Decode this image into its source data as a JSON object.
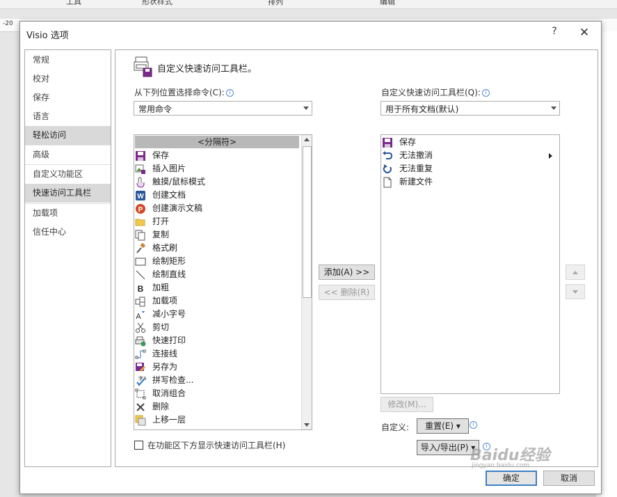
{
  "background": {
    "ribbon_groups": [
      "工具",
      "形状样式",
      "排列",
      "编辑"
    ],
    "ruler_label": "-20"
  },
  "dialog": {
    "title": "Visio 选项",
    "help_label": "?",
    "close_label": "✕"
  },
  "nav": {
    "items": [
      {
        "label": "常规"
      },
      {
        "label": "校对"
      },
      {
        "label": "保存"
      },
      {
        "label": "语言"
      },
      {
        "label": "轻松访问"
      },
      {
        "label": "高级"
      },
      {
        "label": "自定义功能区"
      },
      {
        "label": "快速访问工具栏"
      },
      {
        "label": "加载项"
      },
      {
        "label": "信任中心"
      }
    ],
    "selected": "快速访问工具栏",
    "highlighted": "轻松访问"
  },
  "main": {
    "heading": "自定义快速访问工具栏。",
    "left_label": "从下列位置选择命令(C):",
    "left_combo_value": "常用命令",
    "right_label": "自定义快速访问工具栏(Q):",
    "right_combo_value": "用于所有文档(默认)",
    "commands": [
      {
        "label": "<分隔符>",
        "icon": "separator",
        "separator": true
      },
      {
        "label": "保存",
        "icon": "save-icon"
      },
      {
        "label": "插入图片",
        "icon": "insert-picture-icon"
      },
      {
        "label": "触摸/鼠标模式",
        "icon": "touch-mode-icon",
        "submenu": true
      },
      {
        "label": "创建文档",
        "icon": "word-icon"
      },
      {
        "label": "创建演示文稿",
        "icon": "powerpoint-icon"
      },
      {
        "label": "打开",
        "icon": "folder-open-icon"
      },
      {
        "label": "复制",
        "icon": "copy-icon"
      },
      {
        "label": "格式刷",
        "icon": "format-painter-icon"
      },
      {
        "label": "绘制矩形",
        "icon": "rectangle-icon"
      },
      {
        "label": "绘制直线",
        "icon": "line-icon"
      },
      {
        "label": "加粗",
        "icon": "bold-icon"
      },
      {
        "label": "加载项",
        "icon": "addins-icon",
        "submenu": true
      },
      {
        "label": "减小字号",
        "icon": "decrease-font-icon"
      },
      {
        "label": "剪切",
        "icon": "cut-icon"
      },
      {
        "label": "快速打印",
        "icon": "quick-print-icon"
      },
      {
        "label": "连接线",
        "icon": "connector-icon"
      },
      {
        "label": "另存为",
        "icon": "save-as-icon"
      },
      {
        "label": "拼写检查...",
        "icon": "spelling-icon"
      },
      {
        "label": "取消组合",
        "icon": "ungroup-icon"
      },
      {
        "label": "删除",
        "icon": "delete-icon"
      },
      {
        "label": "上移一层",
        "icon": "bring-forward-icon"
      }
    ],
    "toolbar_items": [
      {
        "label": "保存",
        "icon": "save-icon"
      },
      {
        "label": "无法撤消",
        "icon": "undo-icon",
        "submenu": true
      },
      {
        "label": "无法重复",
        "icon": "redo-icon"
      },
      {
        "label": "新建文件",
        "icon": "new-file-icon"
      }
    ],
    "add_button": "添加(A) >>",
    "remove_button": "<< 删除(R)",
    "modify_button": "修改(M)...",
    "custom_label": "自定义:",
    "reset_button": "重置(E) ▾",
    "import_export_button": "导入/导出(P) ▾",
    "show_below_checkbox": "在功能区下方显示快速访问工具栏(H)",
    "show_below_checked": false
  },
  "footer": {
    "ok_button": "确定",
    "cancel_button": "取消"
  },
  "watermark": {
    "text": "Baidu经验",
    "sub": "jingyan.baidu.com"
  }
}
